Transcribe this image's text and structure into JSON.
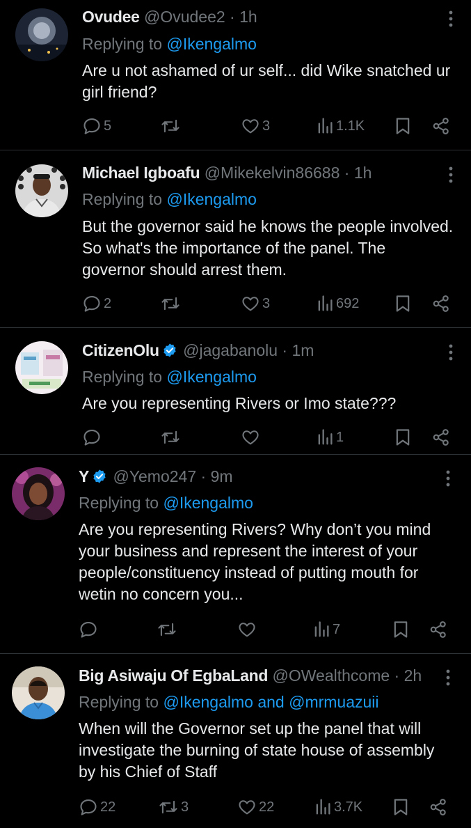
{
  "replying_prefix": "Replying to",
  "and_word": "and",
  "tweets": [
    {
      "name": "Ovudee",
      "handle": "@Ovudee2",
      "time": "1h",
      "verified": false,
      "reply_mentions": [
        "@Ikengalmo"
      ],
      "text": "Are u not ashamed of ur self... did Wike snatched ur\ngirl friend?",
      "replies": "5",
      "retweets": "",
      "likes": "3",
      "views": "1.1K"
    },
    {
      "name": "Michael Igboafu",
      "handle": "@Mikekelvin86688",
      "time": "1h",
      "verified": false,
      "reply_mentions": [
        "@Ikengalmo"
      ],
      "text": "But the governor said he knows the people involved.\nSo what's the importance of the panel. The\ngovernor should arrest them.",
      "replies": "2",
      "retweets": "",
      "likes": "3",
      "views": "692"
    },
    {
      "name": "CitizenOlu",
      "handle": "@jagabanolu",
      "time": "1m",
      "verified": true,
      "reply_mentions": [
        "@Ikengalmo"
      ],
      "text": "Are you representing Rivers or Imo state???",
      "replies": "",
      "retweets": "",
      "likes": "",
      "views": "1"
    },
    {
      "name": "Y",
      "handle": "@Yemo247",
      "time": "9m",
      "verified": true,
      "reply_mentions": [
        "@Ikengalmo"
      ],
      "text": "Are you representing Rivers? Why don’t you mind\nyour business and represent the interest of your\npeople/constituency instead of putting mouth for\nwetin no concern you...",
      "replies": "",
      "retweets": "",
      "likes": "",
      "views": "7"
    },
    {
      "name": "Big Asiwaju Of EgbaLand",
      "handle": "@OWealthcome",
      "time": "2h",
      "verified": false,
      "reply_mentions": [
        "@Ikengalmo",
        "@mrmuazuii"
      ],
      "text": "When will the Governor set up the panel that will\ninvestigate the burning of state house of assembly\nby his Chief of Staff",
      "replies": "22",
      "retweets": "3",
      "likes": "22",
      "views": "3.7K"
    }
  ],
  "icons": [
    "reply-icon",
    "retweet-icon",
    "like-icon",
    "views-icon",
    "bookmark-icon",
    "share-icon",
    "more-icon",
    "verified-badge-icon"
  ],
  "colors": {
    "background": "#000000",
    "text": "#e7e9ea",
    "muted": "#71767b",
    "mention": "#1d9bf0",
    "divider": "#2f3336"
  }
}
